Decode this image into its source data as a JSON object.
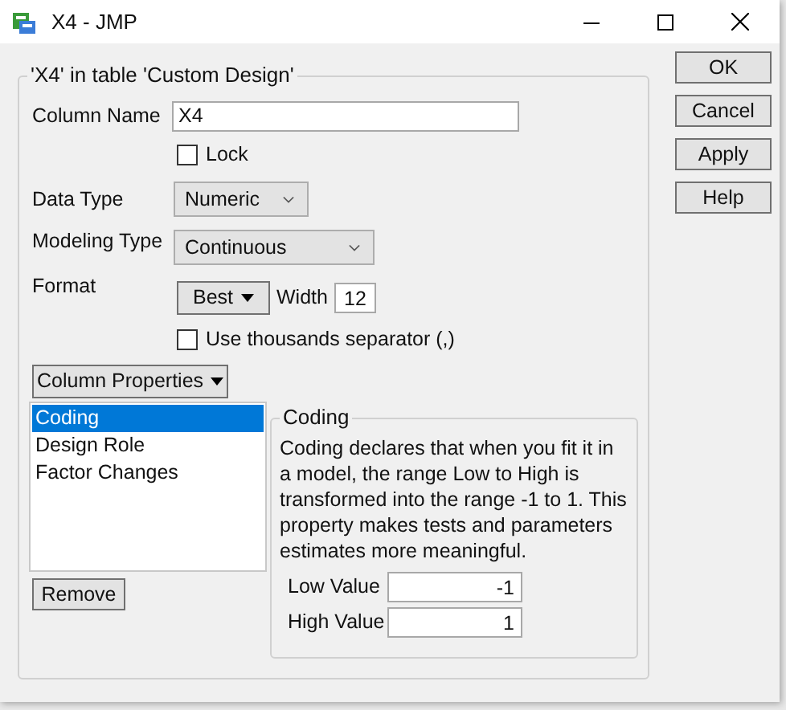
{
  "window": {
    "title": "X4 - JMP"
  },
  "group": {
    "title": "'X4' in table 'Custom Design'"
  },
  "column_name": {
    "label": "Column Name",
    "value": "X4"
  },
  "lock": {
    "label": "Lock",
    "checked": false
  },
  "data_type": {
    "label": "Data Type",
    "value": "Numeric"
  },
  "modeling_type": {
    "label": "Modeling Type",
    "value": "Continuous"
  },
  "format": {
    "label": "Format",
    "button": "Best",
    "width_label": "Width",
    "width_value": "12"
  },
  "thousands": {
    "label": "Use thousands separator (,)",
    "checked": false
  },
  "column_properties": {
    "button": "Column Properties",
    "remove_button": "Remove",
    "items": [
      {
        "label": "Coding",
        "selected": true
      },
      {
        "label": "Design Role",
        "selected": false
      },
      {
        "label": "Factor Changes",
        "selected": false
      }
    ]
  },
  "coding": {
    "title": "Coding",
    "description": "Coding declares that when you fit it in a model, the range Low to High is transformed into the range -1 to 1. This property makes tests and parameters estimates more meaningful.",
    "fields": [
      {
        "label": "Low Value",
        "value": "-1"
      },
      {
        "label": "High Value",
        "value": "1"
      }
    ]
  },
  "buttons": [
    "OK",
    "Cancel",
    "Apply",
    "Help"
  ]
}
